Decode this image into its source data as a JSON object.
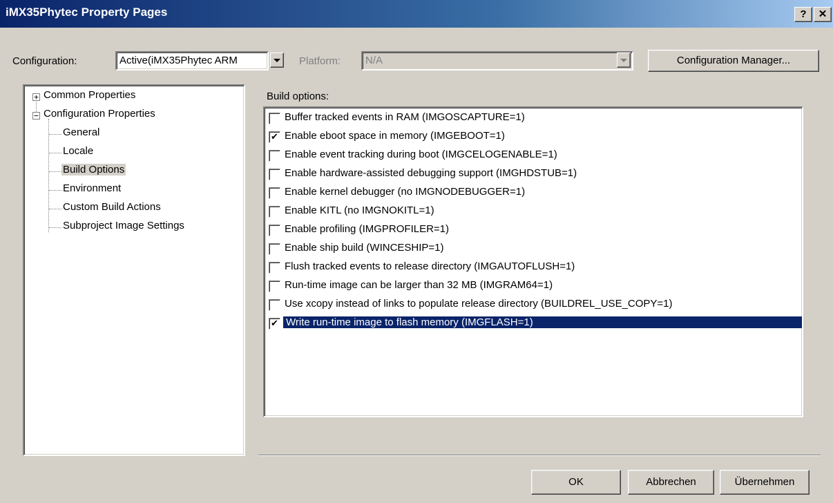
{
  "window": {
    "title": "iMX35Phytec Property Pages",
    "help_glyph": "?",
    "close_glyph": "✕"
  },
  "config": {
    "configuration_label": "Configuration:",
    "configuration_value": "Active(iMX35Phytec ARM",
    "platform_label": "Platform:",
    "platform_value": "N/A",
    "manager_button": "Configuration Manager..."
  },
  "tree": {
    "common": {
      "expander": "+",
      "label": "Common Properties"
    },
    "config": {
      "expander": "−",
      "label": "Configuration Properties"
    },
    "children": [
      "General",
      "Locale",
      "Build Options",
      "Environment",
      "Custom Build Actions",
      "Subproject Image Settings"
    ]
  },
  "build": {
    "label": "Build options:",
    "options": [
      {
        "label": "Buffer tracked events in RAM (IMGOSCAPTURE=1)",
        "checked": false
      },
      {
        "label": "Enable eboot space in memory (IMGEBOOT=1)",
        "checked": true
      },
      {
        "label": "Enable event tracking during boot (IMGCELOGENABLE=1)",
        "checked": false
      },
      {
        "label": "Enable hardware-assisted debugging support (IMGHDSTUB=1)",
        "checked": false
      },
      {
        "label": "Enable kernel debugger (no IMGNODEBUGGER=1)",
        "checked": false
      },
      {
        "label": "Enable KITL (no IMGNOKITL=1)",
        "checked": false
      },
      {
        "label": "Enable profiling (IMGPROFILER=1)",
        "checked": false
      },
      {
        "label": "Enable ship build (WINCESHIP=1)",
        "checked": false
      },
      {
        "label": "Flush tracked events to release directory (IMGAUTOFLUSH=1)",
        "checked": false
      },
      {
        "label": "Run-time image can be larger than 32 MB (IMGRAM64=1)",
        "checked": false
      },
      {
        "label": "Use xcopy instead of links to populate release directory (BUILDREL_USE_COPY=1)",
        "checked": false
      },
      {
        "label": "Write run-time image to flash memory (IMGFLASH=1)",
        "checked": true,
        "selected": true
      }
    ]
  },
  "footer": {
    "ok": "OK",
    "cancel": "Abbrechen",
    "apply": "Übernehmen"
  },
  "colors": {
    "title_start": "#0a246a",
    "title_end": "#a6caf0",
    "face": "#d4d0c8",
    "selection": "#0a246a"
  }
}
